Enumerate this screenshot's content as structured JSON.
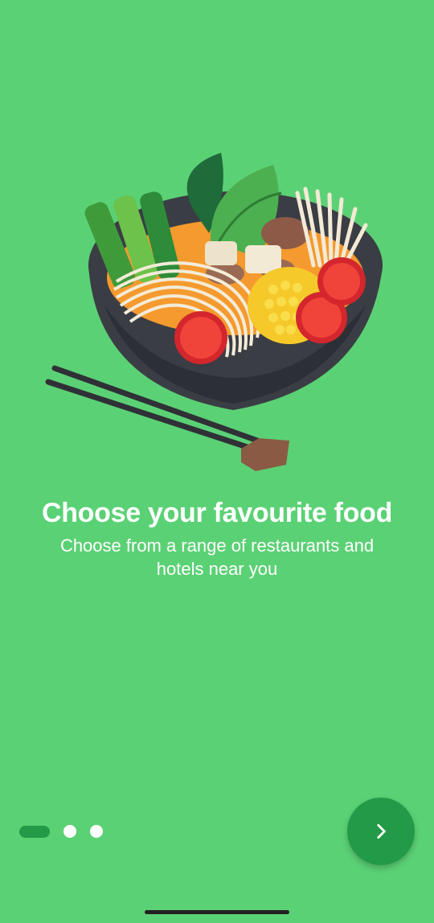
{
  "onboarding": {
    "title": "Choose your favourite food",
    "subtitle": "Choose from a range of restaurants and hotels near you",
    "illustration_icon": "noodle-bowl-illustration",
    "page_indicator": {
      "total": 3,
      "current": 1
    },
    "next_button_icon": "chevron-right-icon"
  },
  "colors": {
    "background": "#5bd175",
    "accent": "#239a47",
    "text": "#ffffff"
  }
}
